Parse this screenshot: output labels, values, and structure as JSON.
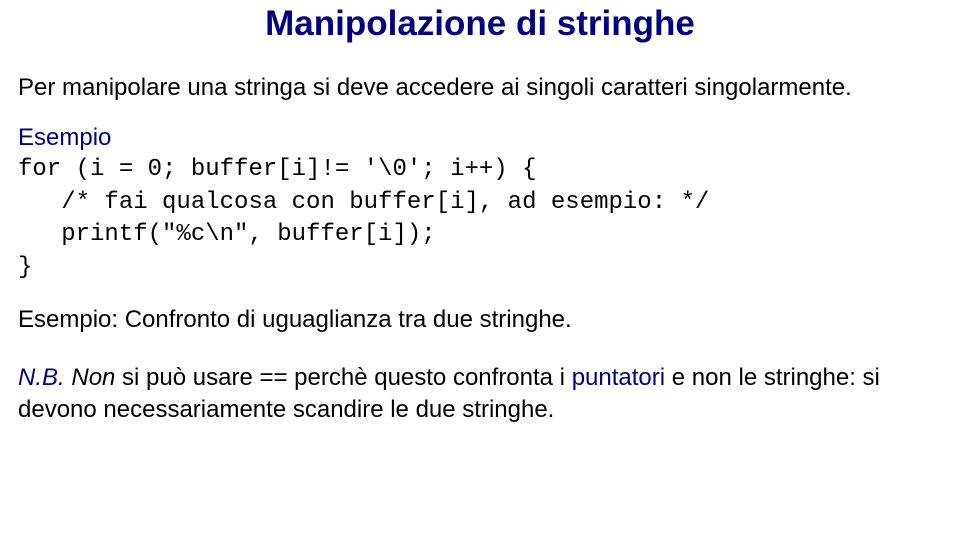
{
  "title": "Manipolazione di stringhe",
  "para1": "Per manipolare una stringa si deve accedere ai singoli caratteri singolarmente.",
  "esempio_label": "Esempio",
  "code_line1": "for (i = 0; buffer[i]!= '\\0'; i++) {",
  "code_line2": "   /* fai qualcosa con buffer[i], ad esempio: */",
  "code_line3": "   printf(\"%c\\n\", buffer[i]);",
  "code_line4": "}",
  "example_compare": "Esempio: Confronto di uguaglianza tra due stringhe.",
  "nb_label": "N.B.",
  "nb_italic": "Non",
  "nb_rest1": " si può usare == perchè questo confronta i ",
  "nb_blue_word": "puntatori",
  "nb_rest2": " e non le stringhe:  si devono necessariamente scandire le due stringhe."
}
